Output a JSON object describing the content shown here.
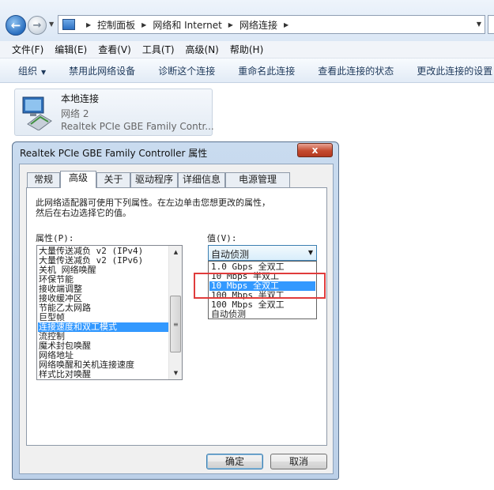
{
  "address": {
    "crumbs": [
      "控制面板",
      "网络和 Internet",
      "网络连接"
    ]
  },
  "menubar": {
    "items": [
      "文件(F)",
      "编辑(E)",
      "查看(V)",
      "工具(T)",
      "高级(N)",
      "帮助(H)"
    ]
  },
  "command_bar": {
    "organize": "组织",
    "items": [
      "禁用此网络设备",
      "诊断这个连接",
      "重命名此连接",
      "查看此连接的状态",
      "更改此连接的设置"
    ]
  },
  "connection": {
    "name": "本地连接",
    "network": "网络  2",
    "adapter": "Realtek PCIe GBE Family Contr..."
  },
  "dialog": {
    "title": "Realtek PCIe GBE Family Controller 属性",
    "close": "x",
    "tabs": [
      "常规",
      "高级",
      "关于",
      "驱动程序",
      "详细信息",
      "电源管理"
    ],
    "active_tab": "高级",
    "description_line1": "此网络适配器可使用下列属性。在左边单击您想更改的属性，",
    "description_line2": "然后在右边选择它的值。",
    "property_label": "属性(P):",
    "value_label": "值(V):",
    "properties": [
      "大量传送减负 v2 (IPv4)",
      "大量传送减负 v2 (IPv6)",
      "关机 网络唤醒",
      "环保节能",
      "接收端调整",
      "接收缓冲区",
      "节能乙太网路",
      "巨型帧",
      "连接速度和双工模式",
      "流控制",
      "魔术封包唤醒",
      "网络地址",
      "网络唤醒和关机连接速度",
      "样式比对唤醒"
    ],
    "selected_property": "连接速度和双工模式",
    "selected_value": "自动侦测",
    "value_options": [
      "1.0 Gbps 全双工",
      "10 Mbps 半双工",
      "10 Mbps 全双工",
      "100 Mbps 半双工",
      "100 Mbps 全双工",
      "自动侦测"
    ],
    "highlighted_option": "10 Mbps 全双工",
    "ok": "确定",
    "cancel": "取消"
  },
  "colors": {
    "selection": "#3399ff",
    "annotation_box": "#e03c3c",
    "command_text": "#1e395b"
  }
}
